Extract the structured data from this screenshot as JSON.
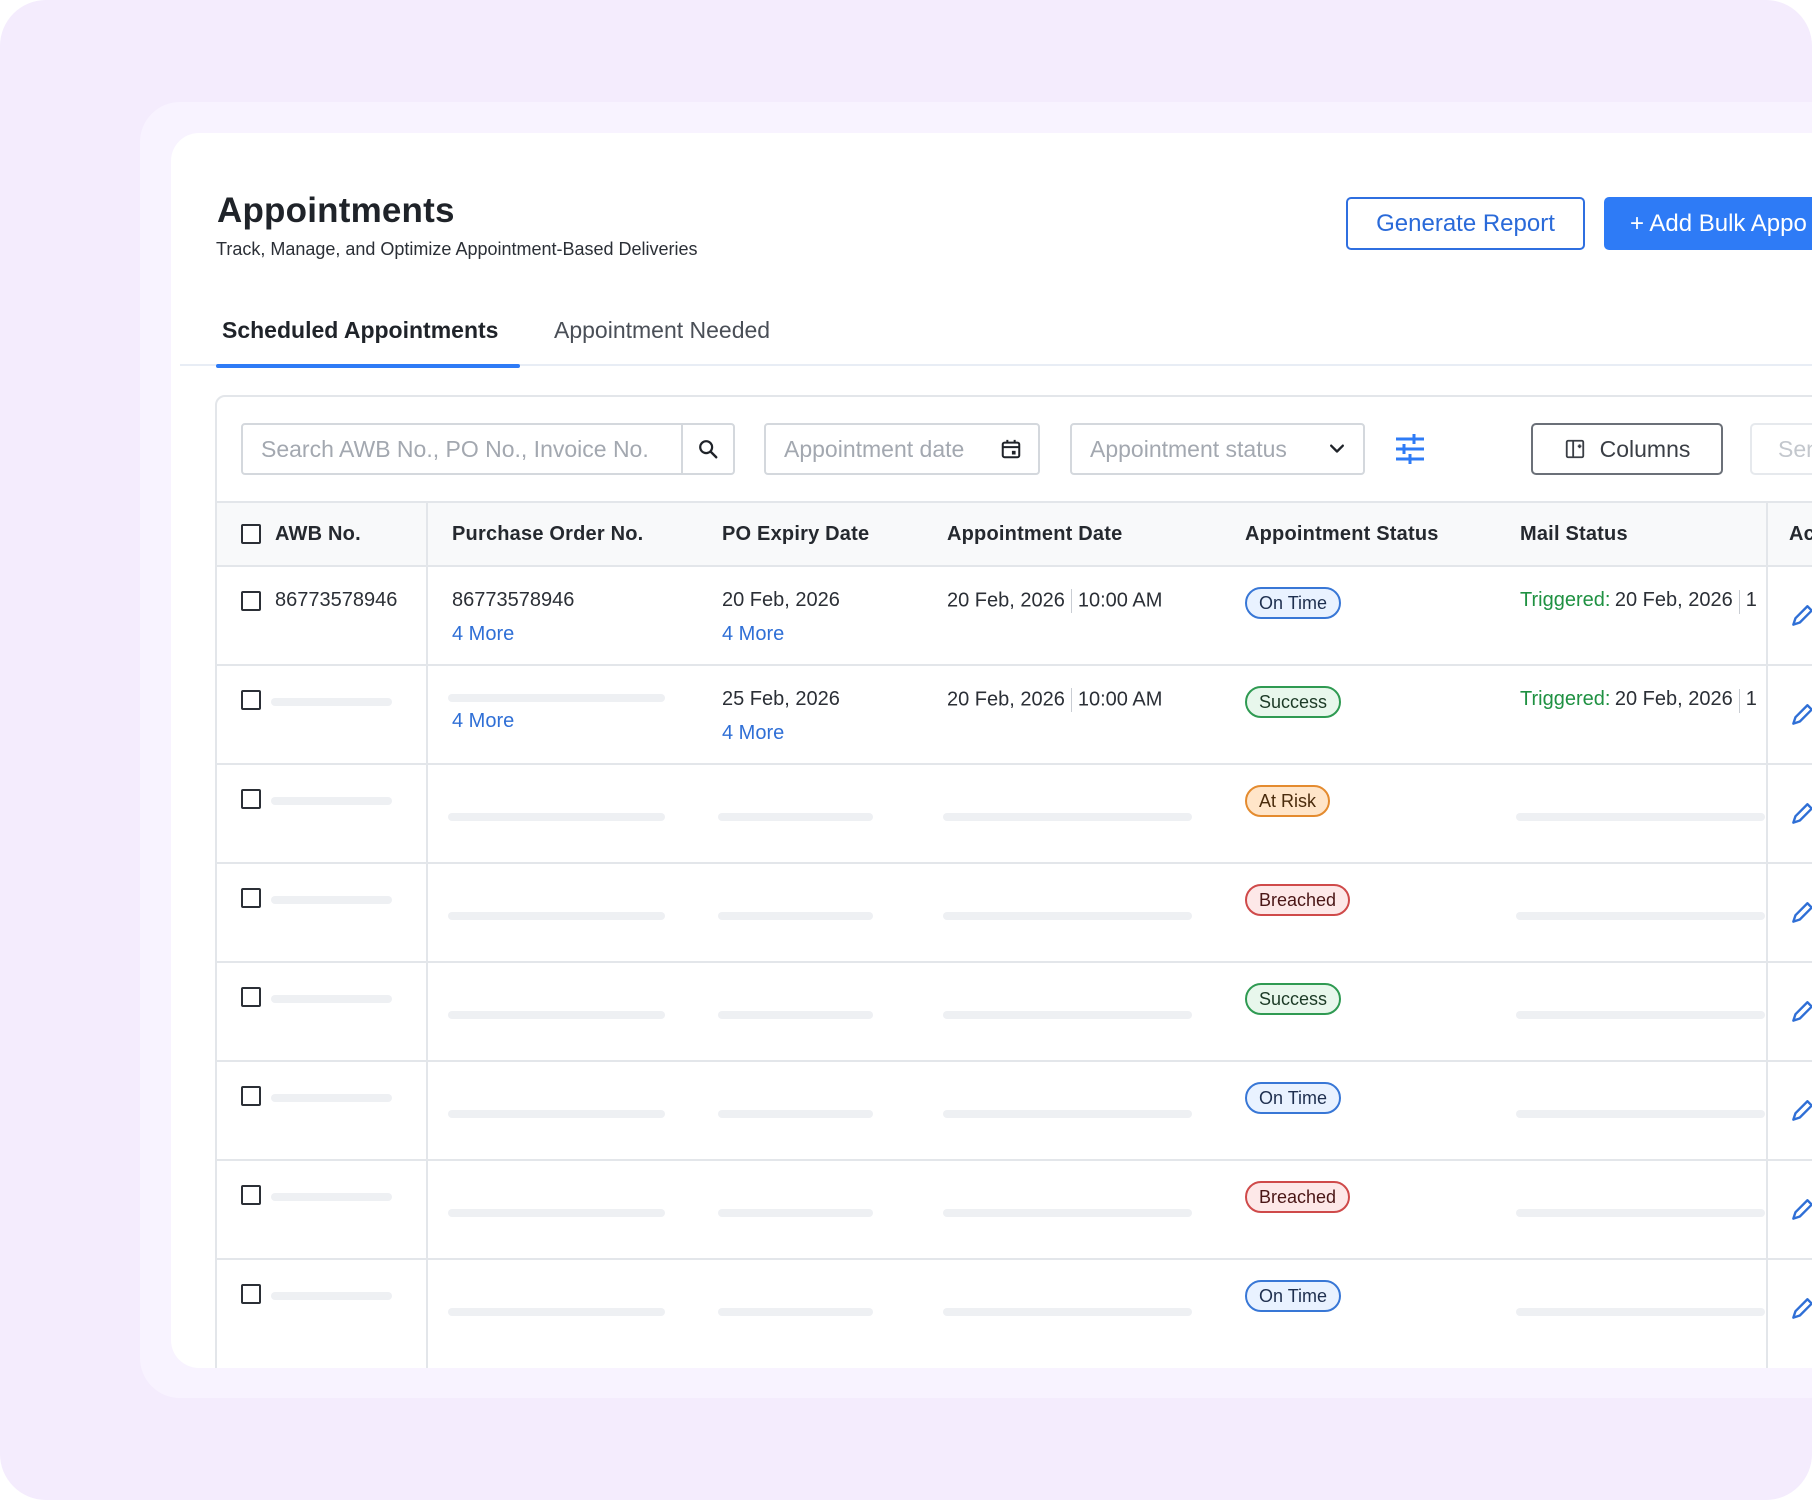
{
  "header": {
    "title": "Appointments",
    "subtitle": "Track, Manage, and Optimize Appointment-Based Deliveries",
    "generate_report_label": "Generate Report",
    "add_bulk_label": "+ Add Bulk Appo"
  },
  "tabs": [
    {
      "label": "Scheduled Appointments",
      "active": true
    },
    {
      "label": "Appointment Needed",
      "active": false
    }
  ],
  "toolbar": {
    "search_placeholder": "Search AWB No., PO No., Invoice No.",
    "date_placeholder": "Appointment date",
    "status_placeholder": "Appointment status",
    "columns_label": "Columns",
    "send_label": "Sen"
  },
  "table": {
    "columns": [
      "AWB No.",
      "Purchase Order No.",
      "PO Expiry Date",
      "Appointment Date",
      "Appointment Status",
      "Mail Status",
      "Ac"
    ],
    "rows": [
      {
        "awb": "86773578946",
        "po": "86773578946",
        "po_more": "4 More",
        "expiry": "20 Feb, 2026",
        "expiry_more": "4 More",
        "appt_date": "20 Feb, 2026",
        "appt_time": "10:00 AM",
        "status": "On Time",
        "mail_label": "Triggered:",
        "mail_date": "20 Feb, 2026",
        "mail_tail": "1"
      },
      {
        "po_more": "4 More",
        "expiry": "25 Feb, 2026",
        "expiry_more": "4 More",
        "appt_date": "20 Feb, 2026",
        "appt_time": "10:00 AM",
        "status": "Success",
        "mail_label": "Triggered:",
        "mail_date": "20 Feb, 2026",
        "mail_tail": "1"
      },
      {
        "status": "At Risk"
      },
      {
        "status": "Breached"
      },
      {
        "status": "Success"
      },
      {
        "status": "On Time"
      },
      {
        "status": "Breached"
      },
      {
        "status": "On Time"
      }
    ]
  },
  "colors": {
    "primary": "#2e7bf6",
    "success": "#2f9a52",
    "warning": "#e48b2f",
    "danger": "#cf4a4a",
    "link": "#2f6fd6",
    "triggered": "#1f9142"
  },
  "icons": [
    "search-icon",
    "calendar-icon",
    "chevron-down-icon",
    "tune-icon",
    "columns-icon",
    "edit-icon"
  ]
}
